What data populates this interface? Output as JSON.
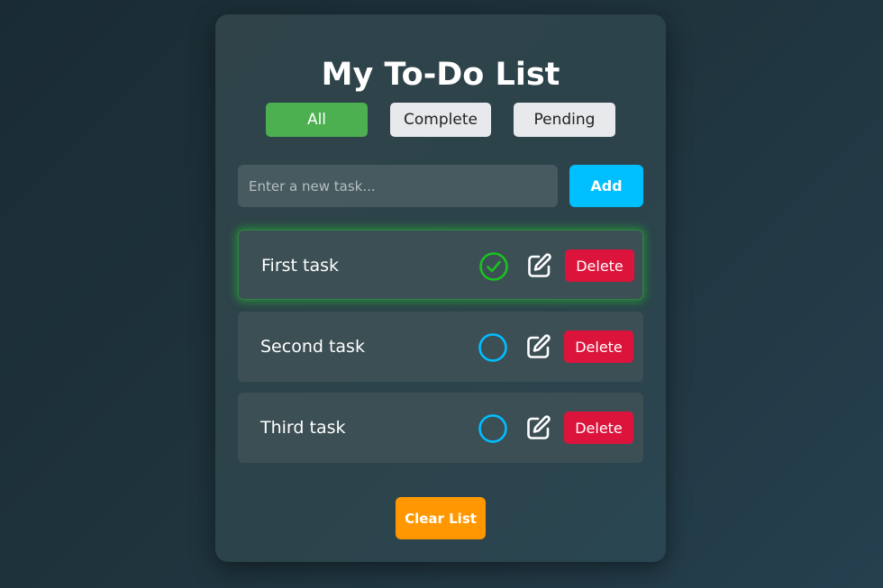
{
  "app": {
    "title": "My To-Do List"
  },
  "filters": [
    {
      "label": "All",
      "active": true
    },
    {
      "label": "Complete",
      "active": false
    },
    {
      "label": "Pending",
      "active": false
    }
  ],
  "new_task": {
    "value": "",
    "placeholder": "Enter a new task...",
    "add_label": "Add"
  },
  "tasks": [
    {
      "text": "First task",
      "completed": true,
      "status_icon": "check-circle-icon",
      "edit_icon": "edit-icon",
      "delete_label": "Delete"
    },
    {
      "text": "Second task",
      "completed": false,
      "status_icon": "empty-circle-icon",
      "edit_icon": "edit-icon",
      "delete_label": "Delete"
    },
    {
      "text": "Third task",
      "completed": false,
      "status_icon": "empty-circle-icon",
      "edit_icon": "edit-icon",
      "delete_label": "Delete"
    }
  ],
  "footer": {
    "clear_label": "Clear List"
  },
  "colors": {
    "filter_active": "#4caf50",
    "filter_inactive": "#e7e9ec",
    "add_button": "#00bfff",
    "delete_button": "#dc143c",
    "clear_button": "#ff9800",
    "completed_check": "#19c21f",
    "pending_circle": "#00bfff"
  }
}
